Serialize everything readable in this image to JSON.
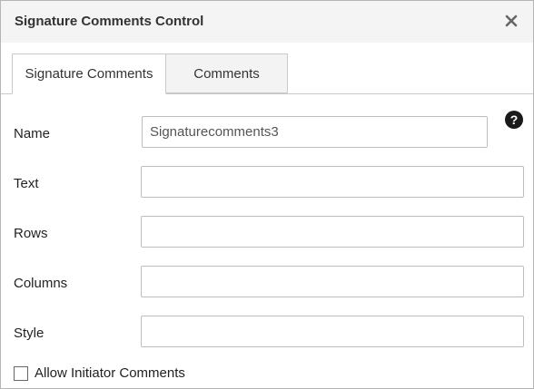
{
  "dialog": {
    "title": "Signature Comments Control",
    "close_icon": "close-icon"
  },
  "tabs": [
    {
      "label": "Signature Comments",
      "active": true
    },
    {
      "label": "Comments",
      "active": false
    }
  ],
  "help_icon": "question-circle-icon",
  "form": {
    "name": {
      "label": "Name",
      "value": "Signaturecomments3"
    },
    "text": {
      "label": "Text",
      "value": ""
    },
    "rows": {
      "label": "Rows",
      "value": ""
    },
    "columns": {
      "label": "Columns",
      "value": ""
    },
    "style": {
      "label": "Style",
      "value": ""
    },
    "allow_initiator_comments": {
      "label": "Allow Initiator Comments",
      "checked": false
    }
  }
}
